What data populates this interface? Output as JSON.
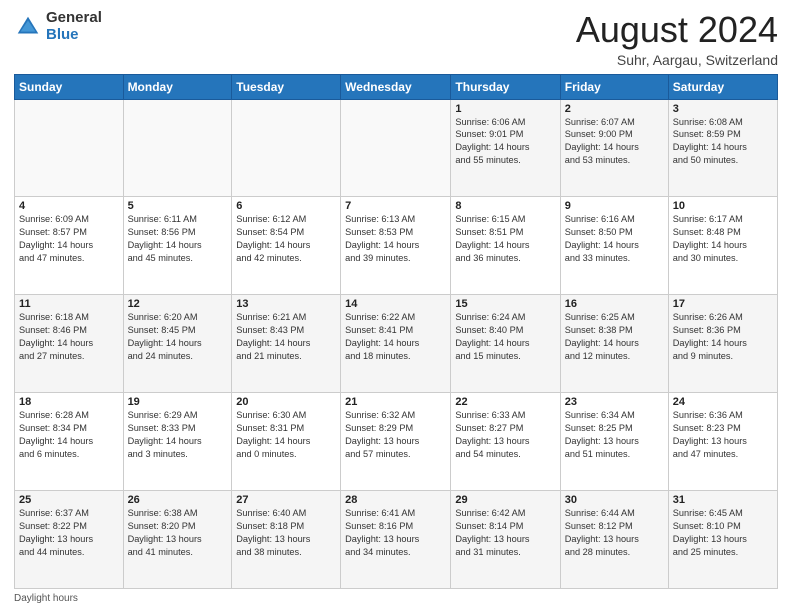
{
  "logo": {
    "general": "General",
    "blue": "Blue"
  },
  "header": {
    "month_year": "August 2024",
    "location": "Suhr, Aargau, Switzerland"
  },
  "weekdays": [
    "Sunday",
    "Monday",
    "Tuesday",
    "Wednesday",
    "Thursday",
    "Friday",
    "Saturday"
  ],
  "weeks": [
    [
      {
        "day": "",
        "info": ""
      },
      {
        "day": "",
        "info": ""
      },
      {
        "day": "",
        "info": ""
      },
      {
        "day": "",
        "info": ""
      },
      {
        "day": "1",
        "info": "Sunrise: 6:06 AM\nSunset: 9:01 PM\nDaylight: 14 hours\nand 55 minutes."
      },
      {
        "day": "2",
        "info": "Sunrise: 6:07 AM\nSunset: 9:00 PM\nDaylight: 14 hours\nand 53 minutes."
      },
      {
        "day": "3",
        "info": "Sunrise: 6:08 AM\nSunset: 8:59 PM\nDaylight: 14 hours\nand 50 minutes."
      }
    ],
    [
      {
        "day": "4",
        "info": "Sunrise: 6:09 AM\nSunset: 8:57 PM\nDaylight: 14 hours\nand 47 minutes."
      },
      {
        "day": "5",
        "info": "Sunrise: 6:11 AM\nSunset: 8:56 PM\nDaylight: 14 hours\nand 45 minutes."
      },
      {
        "day": "6",
        "info": "Sunrise: 6:12 AM\nSunset: 8:54 PM\nDaylight: 14 hours\nand 42 minutes."
      },
      {
        "day": "7",
        "info": "Sunrise: 6:13 AM\nSunset: 8:53 PM\nDaylight: 14 hours\nand 39 minutes."
      },
      {
        "day": "8",
        "info": "Sunrise: 6:15 AM\nSunset: 8:51 PM\nDaylight: 14 hours\nand 36 minutes."
      },
      {
        "day": "9",
        "info": "Sunrise: 6:16 AM\nSunset: 8:50 PM\nDaylight: 14 hours\nand 33 minutes."
      },
      {
        "day": "10",
        "info": "Sunrise: 6:17 AM\nSunset: 8:48 PM\nDaylight: 14 hours\nand 30 minutes."
      }
    ],
    [
      {
        "day": "11",
        "info": "Sunrise: 6:18 AM\nSunset: 8:46 PM\nDaylight: 14 hours\nand 27 minutes."
      },
      {
        "day": "12",
        "info": "Sunrise: 6:20 AM\nSunset: 8:45 PM\nDaylight: 14 hours\nand 24 minutes."
      },
      {
        "day": "13",
        "info": "Sunrise: 6:21 AM\nSunset: 8:43 PM\nDaylight: 14 hours\nand 21 minutes."
      },
      {
        "day": "14",
        "info": "Sunrise: 6:22 AM\nSunset: 8:41 PM\nDaylight: 14 hours\nand 18 minutes."
      },
      {
        "day": "15",
        "info": "Sunrise: 6:24 AM\nSunset: 8:40 PM\nDaylight: 14 hours\nand 15 minutes."
      },
      {
        "day": "16",
        "info": "Sunrise: 6:25 AM\nSunset: 8:38 PM\nDaylight: 14 hours\nand 12 minutes."
      },
      {
        "day": "17",
        "info": "Sunrise: 6:26 AM\nSunset: 8:36 PM\nDaylight: 14 hours\nand 9 minutes."
      }
    ],
    [
      {
        "day": "18",
        "info": "Sunrise: 6:28 AM\nSunset: 8:34 PM\nDaylight: 14 hours\nand 6 minutes."
      },
      {
        "day": "19",
        "info": "Sunrise: 6:29 AM\nSunset: 8:33 PM\nDaylight: 14 hours\nand 3 minutes."
      },
      {
        "day": "20",
        "info": "Sunrise: 6:30 AM\nSunset: 8:31 PM\nDaylight: 14 hours\nand 0 minutes."
      },
      {
        "day": "21",
        "info": "Sunrise: 6:32 AM\nSunset: 8:29 PM\nDaylight: 13 hours\nand 57 minutes."
      },
      {
        "day": "22",
        "info": "Sunrise: 6:33 AM\nSunset: 8:27 PM\nDaylight: 13 hours\nand 54 minutes."
      },
      {
        "day": "23",
        "info": "Sunrise: 6:34 AM\nSunset: 8:25 PM\nDaylight: 13 hours\nand 51 minutes."
      },
      {
        "day": "24",
        "info": "Sunrise: 6:36 AM\nSunset: 8:23 PM\nDaylight: 13 hours\nand 47 minutes."
      }
    ],
    [
      {
        "day": "25",
        "info": "Sunrise: 6:37 AM\nSunset: 8:22 PM\nDaylight: 13 hours\nand 44 minutes."
      },
      {
        "day": "26",
        "info": "Sunrise: 6:38 AM\nSunset: 8:20 PM\nDaylight: 13 hours\nand 41 minutes."
      },
      {
        "day": "27",
        "info": "Sunrise: 6:40 AM\nSunset: 8:18 PM\nDaylight: 13 hours\nand 38 minutes."
      },
      {
        "day": "28",
        "info": "Sunrise: 6:41 AM\nSunset: 8:16 PM\nDaylight: 13 hours\nand 34 minutes."
      },
      {
        "day": "29",
        "info": "Sunrise: 6:42 AM\nSunset: 8:14 PM\nDaylight: 13 hours\nand 31 minutes."
      },
      {
        "day": "30",
        "info": "Sunrise: 6:44 AM\nSunset: 8:12 PM\nDaylight: 13 hours\nand 28 minutes."
      },
      {
        "day": "31",
        "info": "Sunrise: 6:45 AM\nSunset: 8:10 PM\nDaylight: 13 hours\nand 25 minutes."
      }
    ]
  ],
  "footer": {
    "note": "Daylight hours"
  }
}
